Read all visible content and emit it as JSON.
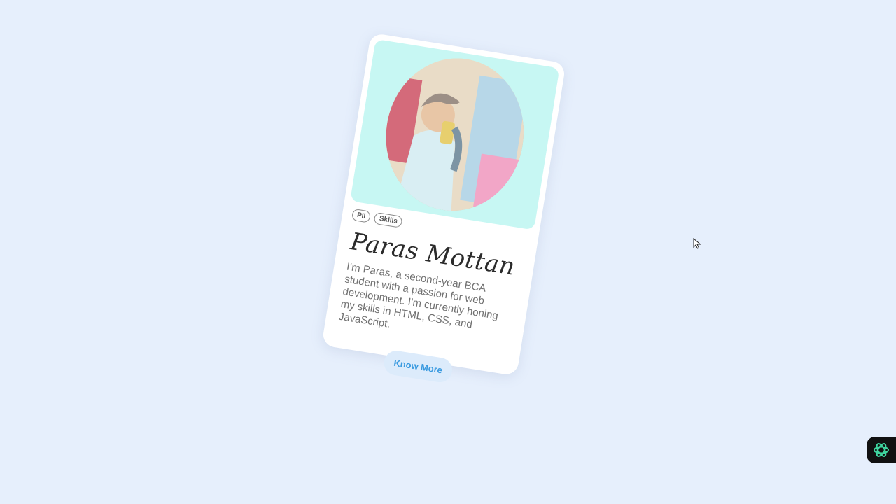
{
  "card": {
    "tags": [
      "PII",
      "Skills"
    ],
    "name": "Paras Mottan",
    "bio": "I'm Paras, a second-year BCA student with a passion for web development. I'm currently honing my skills in HTML, CSS, and JavaScript.",
    "button_label": "Know More"
  },
  "colors": {
    "background": "#e6effc",
    "photo_frame": "#c7f7f3",
    "button_bg": "#dcebfb",
    "button_text": "#3b9be0"
  },
  "icons": {
    "floating_action": "openai-logo-icon",
    "cursor": "mouse-pointer-icon"
  }
}
